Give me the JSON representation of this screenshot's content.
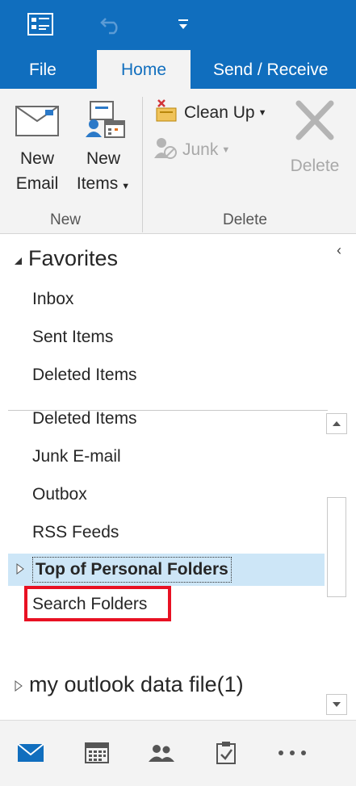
{
  "quick_access": {
    "store_icon": "store-icon",
    "undo_icon": "undo-icon",
    "customize_icon": "customize-qat-icon"
  },
  "tabs": [
    {
      "label": "File"
    },
    {
      "label": "Home"
    },
    {
      "label": "Send / Receive"
    }
  ],
  "ribbon": {
    "new_email": {
      "line1": "New",
      "line2": "Email"
    },
    "new_items": {
      "line1": "New",
      "line2": "Items"
    },
    "group_new": "New",
    "clean_up": "Clean Up",
    "junk": "Junk",
    "delete": "Delete",
    "group_delete": "Delete"
  },
  "folder_pane": {
    "favorites_header": "Favorites",
    "favorites": [
      "Inbox",
      "Sent Items",
      "Deleted Items"
    ],
    "folders": [
      "Deleted Items",
      "Junk E-mail",
      "Outbox",
      "RSS Feeds"
    ],
    "top_personal": "Top of Personal Folders",
    "search_folders": "Search Folders",
    "data_file": "my outlook data file(1)"
  },
  "bottom_nav": [
    "mail-icon",
    "calendar-icon",
    "people-icon",
    "tasks-icon",
    "more-icon"
  ],
  "colors": {
    "brand": "#106ebe",
    "ribbon_bg": "#f3f3f3",
    "selected_row": "#cde6f7",
    "highlight_box": "#e81123"
  }
}
